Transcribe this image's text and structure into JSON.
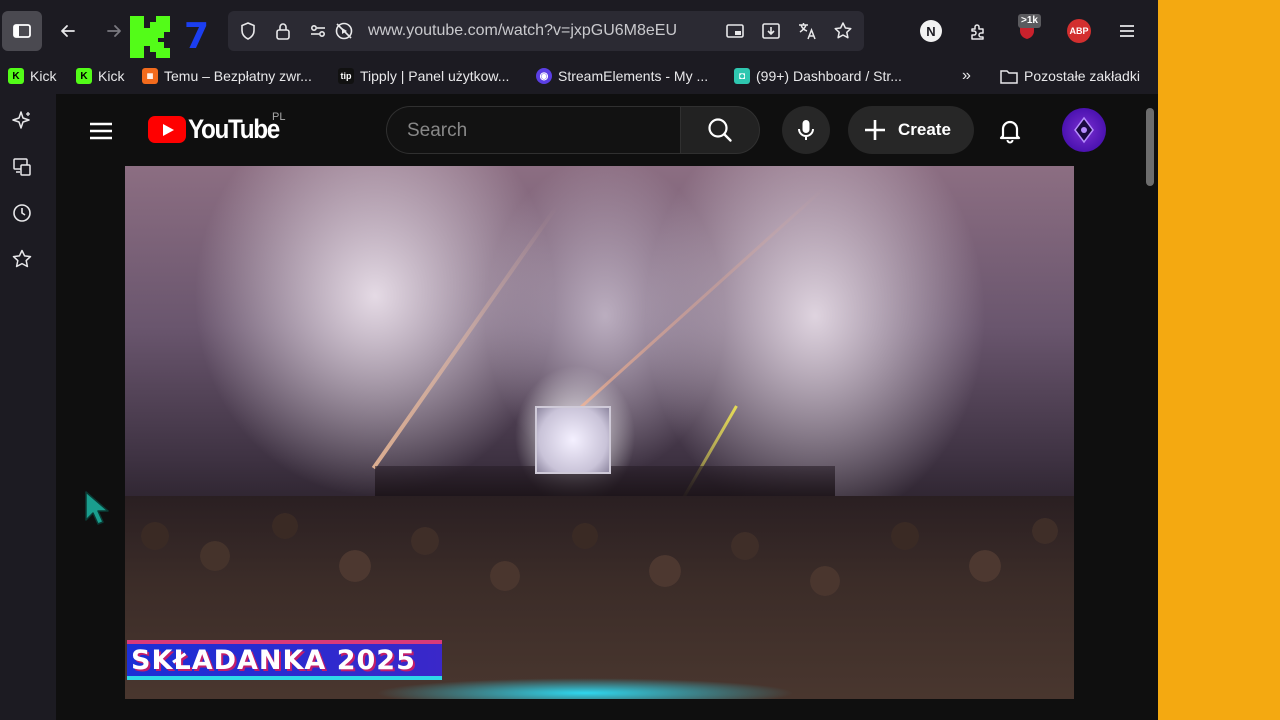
{
  "browser": {
    "url": "www.youtube.com/watch?v=jxpGU6M8eEU",
    "kick_seven": "7",
    "ext_n_label": "N",
    "ublock_badge": ">1k",
    "abp_label": "ABP"
  },
  "bookmarks": [
    {
      "label": "Kick",
      "icon": "kick-icon",
      "color": "#53fc18"
    },
    {
      "label": "Kick",
      "icon": "kick-icon",
      "color": "#53fc18"
    },
    {
      "label": "Temu – Bezpłatny zwr...",
      "icon": "temu-icon",
      "color": "#f26b1d"
    },
    {
      "label": "Tipply | Panel użytkow...",
      "icon": "tipply-icon",
      "color": "#ffffff"
    },
    {
      "label": "StreamElements - My ...",
      "icon": "streamelements-icon",
      "color": "#5b3fe4"
    },
    {
      "label": "(99+) Dashboard / Str...",
      "icon": "dashboard-icon",
      "color": "#2fc7b0"
    }
  ],
  "bookmarks_more": "»",
  "other_bookmarks": "Pozostałe zakładki",
  "youtube": {
    "wordmark": "YouTube",
    "country": "PL",
    "search_placeholder": "Search",
    "create_label": "Create"
  },
  "video": {
    "overlay_title": "SKŁADANKA 2025"
  },
  "colors": {
    "accent_orange": "#f4a911",
    "youtube_red": "#ff0000",
    "kick_green": "#53fc18"
  }
}
